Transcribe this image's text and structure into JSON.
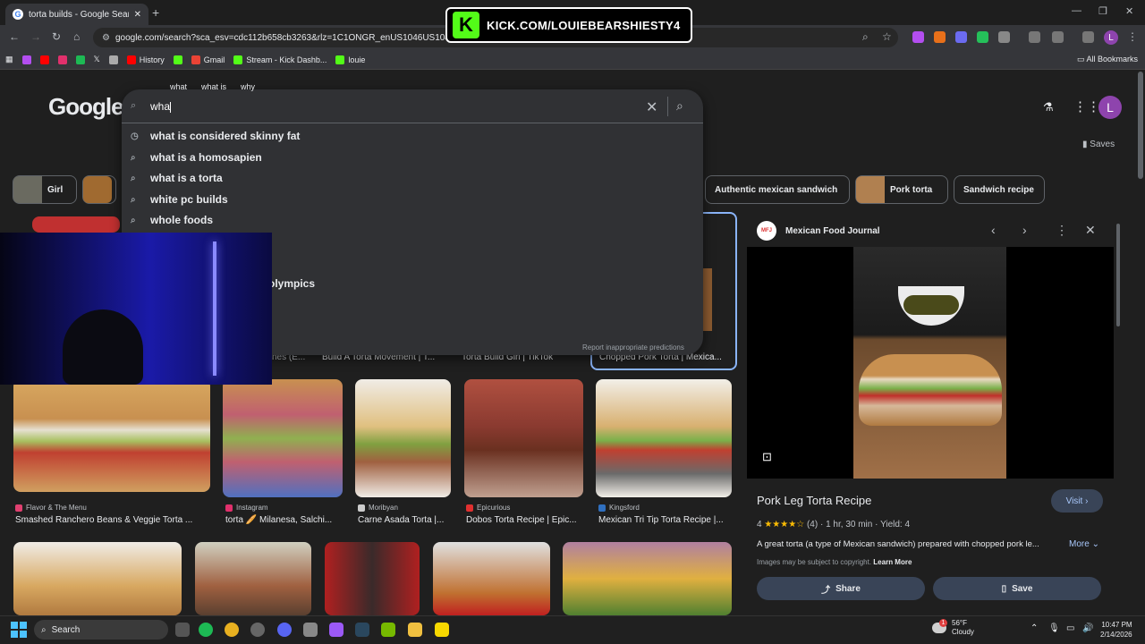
{
  "browser": {
    "tab_title": "torta builds - Google Search",
    "new_tab": "+",
    "url": "google.com/search?sca_esv=cdc112b658cb3263&rlz=1C1ONGR_enUS1046US1046&sxsrf=...&udm=2&fbs=ADc_l-aN0CWEZBOHjofHoaMM...",
    "bookmarks": [
      "History",
      "Gmail",
      "Stream - Kick Dashb...",
      "louie"
    ],
    "all_bookmarks": "All Bookmarks",
    "profile_initial": "L"
  },
  "kick_banner": {
    "icon_letter": "K",
    "url": "KICK.COM/LOUIEBEARSHIESTY4"
  },
  "google": {
    "logo": "Google",
    "query_chips": [
      "what",
      "what is",
      "why"
    ],
    "search_value": "wha",
    "suggestions": [
      "what is considered skinny fat",
      "what is a homosapien",
      "what is a torta",
      "white pc builds",
      "whole foods",
      "olympics"
    ],
    "report": "Report inappropriate predictions",
    "saves": "Saves",
    "avatar_initial": "L"
  },
  "filter_chips": [
    "Girl",
    "Authentic mexican sandwich",
    "Pork torta",
    "Sandwich recipe"
  ],
  "partial_captions": [
    "hes (E...",
    "Build A Torta Movement | T...",
    "Torta Build Girl | TikTok",
    "Chopped Pork Torta | Mexica..."
  ],
  "results": [
    {
      "source": "Flavor & The Menu",
      "title": "Smashed Ranchero Beans & Veggie Torta ..."
    },
    {
      "source": "Instagram",
      "title": "torta 🥖 Milanesa, Salchi..."
    },
    {
      "source": "Moribyan",
      "title": "Carne Asada Torta |..."
    },
    {
      "source": "Epicurious",
      "title": "Dobos Torta Recipe | Epic..."
    },
    {
      "source": "Kingsford",
      "title": "Mexican Tri Tip Torta Recipe |..."
    }
  ],
  "side_panel": {
    "source": "Mexican Food Journal",
    "title": "Pork Leg Torta Recipe",
    "visit": "Visit",
    "rating_value": "4",
    "rating_count": "(4)",
    "time": "1 hr, 30 min",
    "yield": "Yield: 4",
    "description": "A great torta (a type of Mexican sandwich) prepared with chopped pork le...",
    "more": "More",
    "copyright": "Images may be subject to copyright.",
    "learn_more": "Learn More",
    "share": "Share",
    "save": "Save"
  },
  "taskbar": {
    "search": "Search",
    "temp": "56°F",
    "weather": "Cloudy",
    "notification_count": "1",
    "time": "10:47 PM",
    "date": "2/14/2026"
  },
  "colors": {
    "kick_green": "#53fc18",
    "link_blue": "#a8c7fa",
    "star_yellow": "#fbbc04"
  }
}
